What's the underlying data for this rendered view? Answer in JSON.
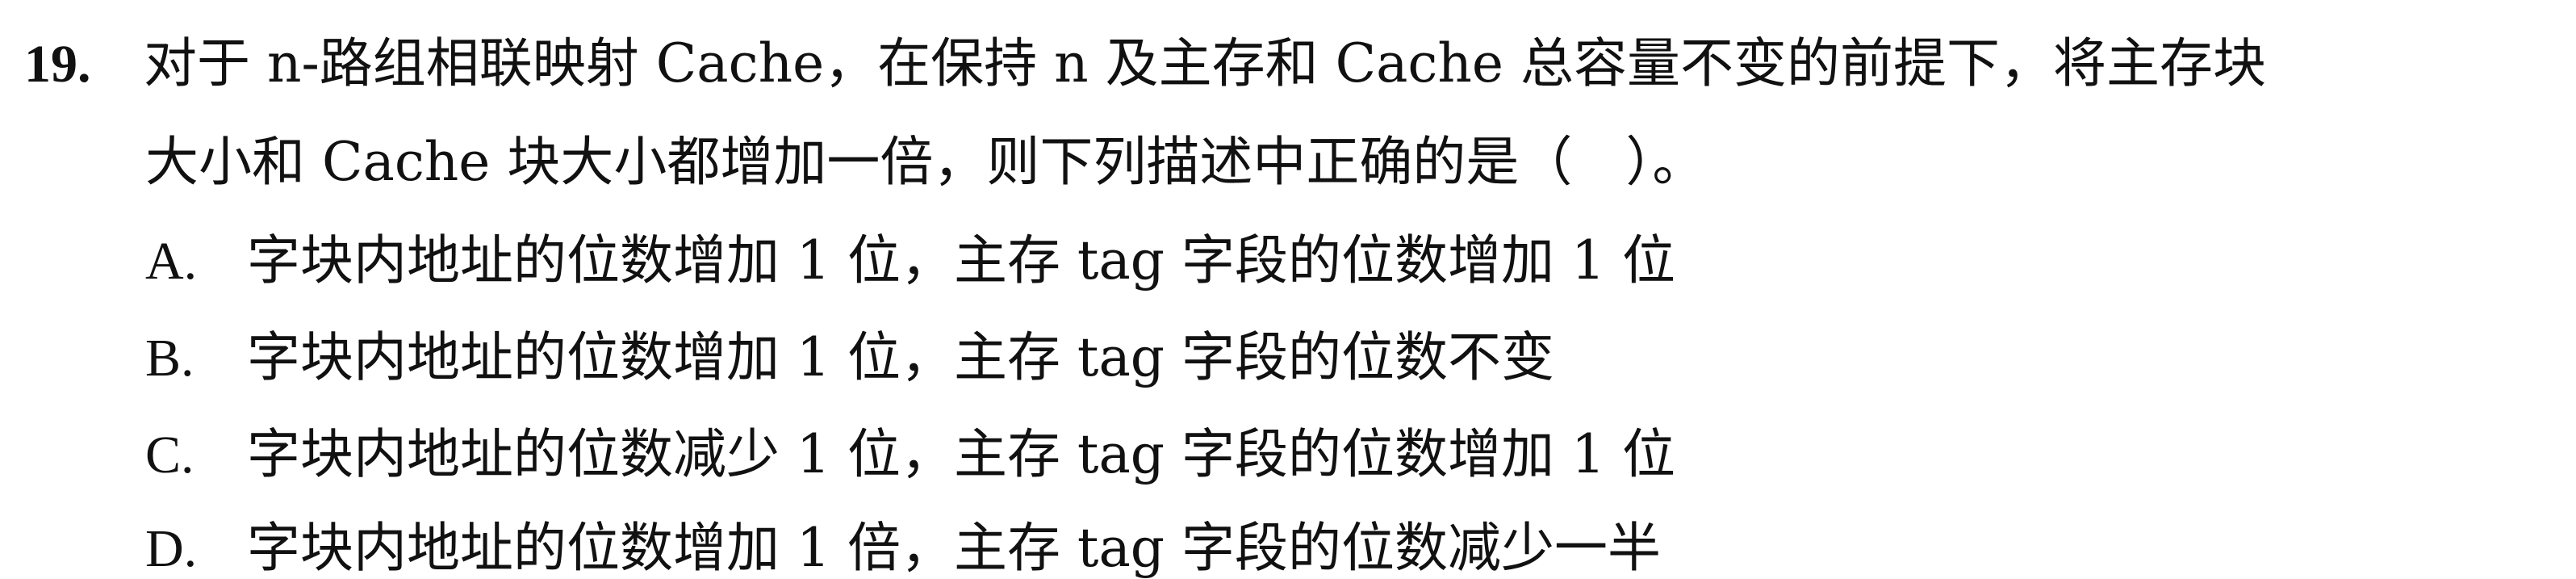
{
  "question": {
    "number": "19.",
    "stem_line1": "对于 n-路组相联映射 Cache，在保持 n 及主存和 Cache 总容量不变的前提下，将主存块",
    "stem_line2": "大小和 Cache 块大小都增加一倍，则下列描述中正确的是（　）。",
    "options": [
      {
        "label": "A.",
        "text": "字块内地址的位数增加 1 位，主存 tag 字段的位数增加 1 位"
      },
      {
        "label": "B.",
        "text": "字块内地址的位数增加 1 位，主存 tag 字段的位数不变"
      },
      {
        "label": "C.",
        "text": "字块内地址的位数减少 1 位，主存 tag 字段的位数增加 1 位"
      },
      {
        "label": "D.",
        "text": "字块内地址的位数增加 1 倍，主存 tag 字段的位数减少一半"
      }
    ]
  }
}
